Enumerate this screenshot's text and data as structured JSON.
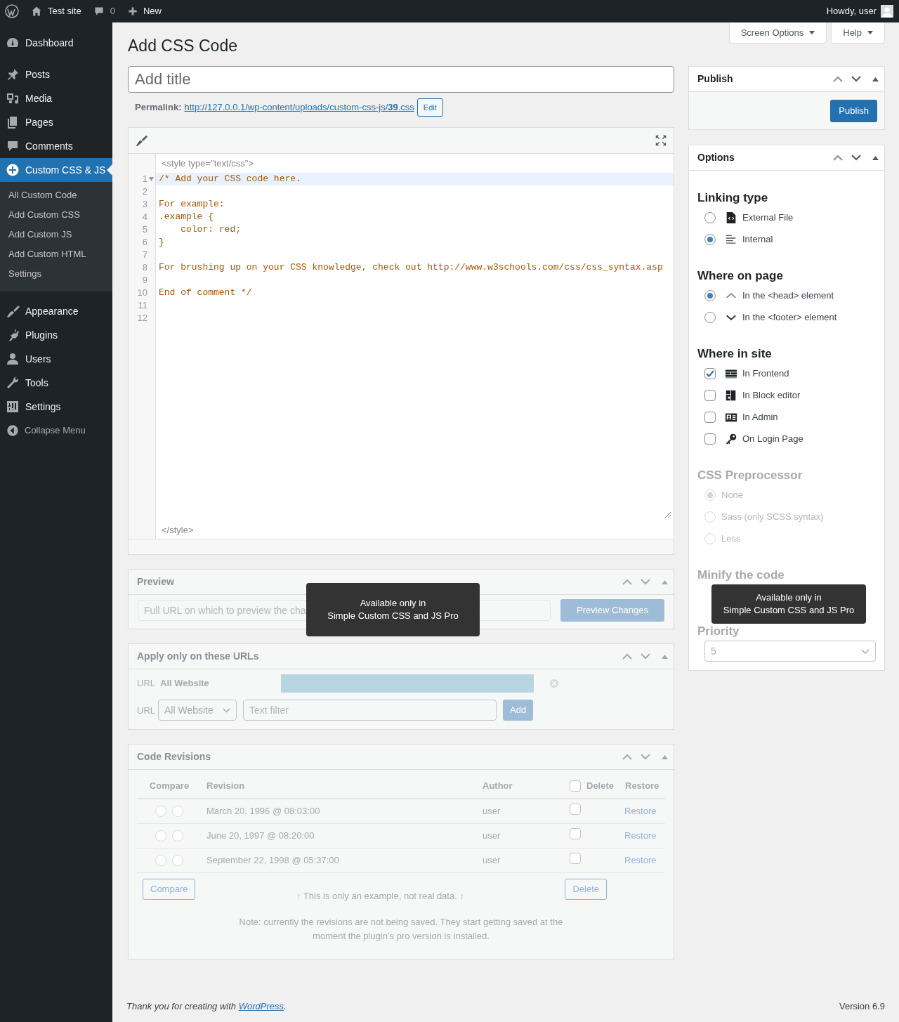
{
  "admin_bar": {
    "site": "Test site",
    "comments": "0",
    "new": "New",
    "greeting": "Howdy, user"
  },
  "sidebar": {
    "groups": [
      {
        "items": [
          {
            "label": "Dashboard",
            "selected": false
          }
        ]
      },
      {
        "items": [
          {
            "label": "Posts",
            "selected": false
          },
          {
            "label": "Media",
            "selected": false
          },
          {
            "label": "Pages",
            "selected": false
          },
          {
            "label": "Comments",
            "selected": false
          },
          {
            "label": "Custom CSS & JS",
            "selected": true,
            "children": [
              {
                "label": "All Custom Code",
                "selected": false
              },
              {
                "label": "Add Custom CSS",
                "selected": false
              },
              {
                "label": "Add Custom JS",
                "selected": false
              },
              {
                "label": "Add Custom HTML",
                "selected": false
              },
              {
                "label": "Settings",
                "selected": false
              }
            ]
          }
        ]
      },
      {
        "items": [
          {
            "label": "Appearance",
            "selected": false
          },
          {
            "label": "Plugins",
            "selected": false
          },
          {
            "label": "Users",
            "selected": false
          },
          {
            "label": "Tools",
            "selected": false
          },
          {
            "label": "Settings",
            "selected": false
          }
        ]
      }
    ],
    "collapse": "Collapse Menu"
  },
  "screen_options": "Screen Options",
  "help": "Help",
  "title": "Add CSS Code",
  "title_field": {
    "placeholder": "Add title"
  },
  "permalink": {
    "label": "Permalink:",
    "url": "http://127.0.0.1/wp-content/uploads/custom-css-js/**39**.css",
    "button": "Edit"
  },
  "editor": {
    "open_tag": "<style type=\"text/css\">",
    "close_tag": "</style>",
    "lines": [
      {
        "number": "1",
        "text": "/* Add your CSS code here.",
        "selected": true,
        "expanded": true
      },
      {
        "number": "2",
        "selected": false
      },
      {
        "number": "3",
        "text": "For example:",
        "selected": false
      },
      {
        "number": "4",
        "text": ".example {",
        "selected": false
      },
      {
        "number": "5",
        "text": "    color: red;",
        "selected": false
      },
      {
        "number": "6",
        "text": "}",
        "selected": false
      },
      {
        "number": "7",
        "selected": false
      },
      {
        "number": "8",
        "text": "For brushing up on your CSS knowledge, check out http://www.w3schools.com/css/css_syntax.asp",
        "selected": false
      },
      {
        "number": "9",
        "selected": false
      },
      {
        "number": "10",
        "text": "End of comment */",
        "selected": false
      },
      {
        "number": "11",
        "selected": false
      },
      {
        "number": "12",
        "selected": false
      }
    ]
  },
  "preview": {
    "title": "Preview",
    "disabled": true,
    "placeholder": "Full URL on which to preview the cha",
    "button": "Preview Changes",
    "tooltip": "Available only in\nSimple Custom CSS and JS Pro"
  },
  "apply_urls": {
    "title": "Apply only on these URLs",
    "disabled": true,
    "rule": {
      "label": "URL",
      "value": "All Website"
    },
    "new_rule": {
      "label": "URL",
      "select": "All Website",
      "placeholder": "Text filter",
      "button": "Add"
    }
  },
  "revisions": {
    "title": "Code Revisions",
    "disabled": true,
    "columns": [
      "Compare",
      "Revision",
      "Author",
      "Delete",
      "Restore"
    ],
    "select_all_checked": false,
    "rows": [
      {
        "from_selected": false,
        "to_selected": false,
        "revision": "March 20, 1996 @ 08:03:00",
        "author": "user",
        "checked": false,
        "action": "Restore"
      },
      {
        "from_selected": false,
        "to_selected": false,
        "revision": "June 20, 1997 @ 08:20:00",
        "author": "user",
        "checked": false,
        "action": "Restore"
      },
      {
        "from_selected": false,
        "to_selected": false,
        "revision": "September 22, 1998 @ 05:37:00",
        "author": "user",
        "checked": false,
        "action": "Restore"
      }
    ],
    "compare_button": "Compare",
    "delete_button": "Delete",
    "example_note": "↑ This is only an example, not real data. ↑",
    "note": "Note: currently the revisions are not being saved. They start getting saved at the moment the plugin's pro version is installed."
  },
  "publish": {
    "title": "Publish",
    "button": "Publish"
  },
  "options": {
    "title": "Options",
    "sections": [
      {
        "heading": "Linking type",
        "disabled": false,
        "options": [
          {
            "kind": "radio",
            "label": "External File",
            "checked": false
          },
          {
            "kind": "radio",
            "label": "Internal",
            "checked": true
          }
        ]
      },
      {
        "heading": "Where on page",
        "disabled": false,
        "options": [
          {
            "kind": "radio",
            "label": "In the <head> element",
            "checked": true
          },
          {
            "kind": "radio",
            "label": "In the <footer> element",
            "checked": false
          }
        ]
      },
      {
        "heading": "Where in site",
        "disabled": false,
        "options": [
          {
            "kind": "checkbox",
            "label": "In Frontend",
            "checked": true
          },
          {
            "kind": "checkbox",
            "label": "In Block editor",
            "checked": false
          },
          {
            "kind": "checkbox",
            "label": "In Admin",
            "checked": false
          },
          {
            "kind": "checkbox",
            "label": "On Login Page",
            "checked": false
          }
        ]
      },
      {
        "heading": "CSS Preprocessor",
        "disabled": true,
        "options": [
          {
            "kind": "radio",
            "label": "None",
            "checked": true
          },
          {
            "kind": "radio",
            "label": "Sass (only SCSS syntax)",
            "checked": false
          },
          {
            "kind": "radio",
            "label": "Less",
            "checked": false
          }
        ]
      },
      {
        "heading": "Minify the code",
        "disabled": true
      }
    ],
    "priority": {
      "label": "Priority",
      "value": "5",
      "disabled": true
    },
    "tooltip": "Available only in\nSimple Custom CSS and JS Pro"
  },
  "footer": {
    "before": "Thank you for creating with ",
    "link": "WordPress",
    "after": ".",
    "version": "Version 6.9"
  }
}
